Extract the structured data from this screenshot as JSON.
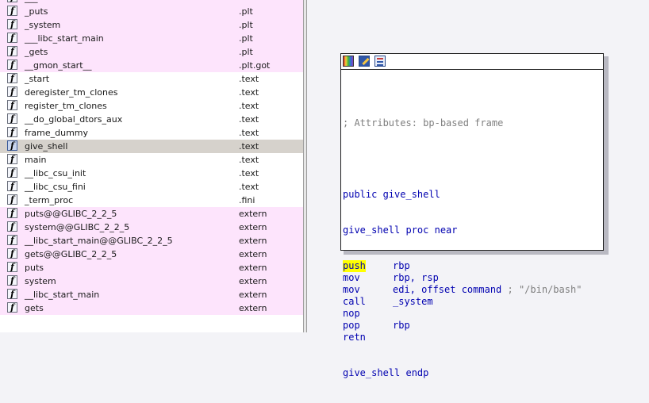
{
  "functions": [
    {
      "name": "___",
      "segment": "",
      "style": "pink"
    },
    {
      "name": "_puts",
      "segment": ".plt",
      "style": "pink"
    },
    {
      "name": "_system",
      "segment": ".plt",
      "style": "pink"
    },
    {
      "name": "___libc_start_main",
      "segment": ".plt",
      "style": "pink"
    },
    {
      "name": "_gets",
      "segment": ".plt",
      "style": "pink"
    },
    {
      "name": "__gmon_start__",
      "segment": ".plt.got",
      "style": "pink"
    },
    {
      "name": "_start",
      "segment": ".text",
      "style": "white"
    },
    {
      "name": "deregister_tm_clones",
      "segment": ".text",
      "style": "white"
    },
    {
      "name": "register_tm_clones",
      "segment": ".text",
      "style": "white"
    },
    {
      "name": "__do_global_dtors_aux",
      "segment": ".text",
      "style": "white"
    },
    {
      "name": "frame_dummy",
      "segment": ".text",
      "style": "white"
    },
    {
      "name": "give_shell",
      "segment": ".text",
      "style": "selected"
    },
    {
      "name": "main",
      "segment": ".text",
      "style": "white"
    },
    {
      "name": "__libc_csu_init",
      "segment": ".text",
      "style": "white"
    },
    {
      "name": "__libc_csu_fini",
      "segment": ".text",
      "style": "white"
    },
    {
      "name": "_term_proc",
      "segment": ".fini",
      "style": "white"
    },
    {
      "name": "puts@@GLIBC_2_2_5",
      "segment": "extern",
      "style": "pink"
    },
    {
      "name": "system@@GLIBC_2_2_5",
      "segment": "extern",
      "style": "pink"
    },
    {
      "name": "__libc_start_main@@GLIBC_2_2_5",
      "segment": "extern",
      "style": "pink"
    },
    {
      "name": "gets@@GLIBC_2_2_5",
      "segment": "extern",
      "style": "pink"
    },
    {
      "name": "puts",
      "segment": "extern",
      "style": "pink"
    },
    {
      "name": "system",
      "segment": "extern",
      "style": "pink"
    },
    {
      "name": "__libc_start_main",
      "segment": "extern",
      "style": "pink"
    },
    {
      "name": "gets",
      "segment": "extern",
      "style": "pink"
    }
  ],
  "function_icon_glyph": "f",
  "graph_node": {
    "toolbar_icons": [
      "color-palette-icon",
      "rename-icon",
      "graph-overview-icon"
    ],
    "comment": "; Attributes: bp-based frame",
    "public_line": "public give_shell",
    "proc_line": "give_shell proc near",
    "instructions": [
      {
        "mnemonic": "push",
        "operands": "rbp",
        "highlight": true,
        "comment": ""
      },
      {
        "mnemonic": "mov",
        "operands": "rbp, rsp",
        "highlight": false,
        "comment": ""
      },
      {
        "mnemonic": "mov",
        "operands": "edi, offset command",
        "highlight": false,
        "comment": " ; \"/bin/bash\""
      },
      {
        "mnemonic": "call",
        "operands": "_system",
        "highlight": false,
        "comment": ""
      },
      {
        "mnemonic": "nop",
        "operands": "",
        "highlight": false,
        "comment": ""
      },
      {
        "mnemonic": "pop",
        "operands": "rbp",
        "highlight": false,
        "comment": ""
      },
      {
        "mnemonic": "retn",
        "operands": "",
        "highlight": false,
        "comment": ""
      }
    ],
    "endp_line": "give_shell endp"
  },
  "colors": {
    "row_pink": "#fde4fc",
    "row_selected": "#d6d2cc",
    "code_blue": "#0000b0",
    "comment_gray": "#7f7f7f",
    "highlight_yellow": "#ffff00"
  }
}
